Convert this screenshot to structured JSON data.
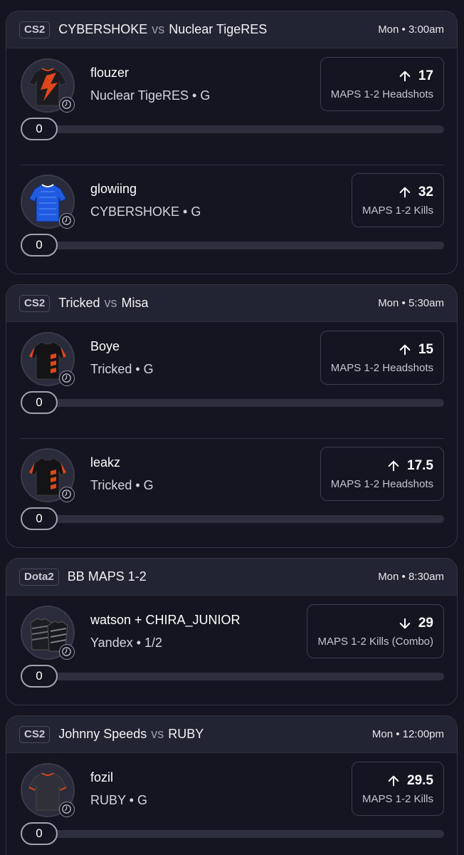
{
  "colors": {
    "background": "#141521",
    "card_header": "#232433",
    "border": "#333547",
    "text_primary": "#ffffff",
    "text_secondary": "#c3c4cd"
  },
  "matches": [
    {
      "game": "CS2",
      "team1": "CYBERSHOKE",
      "vs": "vs",
      "team2": "Nuclear TigeRES",
      "time": "Mon • 3:00am",
      "picks": [
        {
          "player": "flouzer",
          "meta": "Nuclear TigeRES • G",
          "direction": "up",
          "direction_icon": "arrow-up-icon",
          "line": "17",
          "market": "MAPS 1-2 Headshots",
          "slider_value": "0",
          "jersey": "orange-black"
        },
        {
          "player": "glowiing",
          "meta": "CYBERSHOKE • G",
          "direction": "up",
          "direction_icon": "arrow-up-icon",
          "line": "32",
          "market": "MAPS 1-2 Kills",
          "slider_value": "0",
          "jersey": "blue"
        }
      ]
    },
    {
      "game": "CS2",
      "team1": "Tricked",
      "vs": "vs",
      "team2": "Misa",
      "time": "Mon • 5:30am",
      "picks": [
        {
          "player": "Boye",
          "meta": "Tricked • G",
          "direction": "up",
          "direction_icon": "arrow-up-icon",
          "line": "15",
          "market": "MAPS 1-2 Headshots",
          "slider_value": "0",
          "jersey": "black-red"
        },
        {
          "player": "leakz",
          "meta": "Tricked • G",
          "direction": "up",
          "direction_icon": "arrow-up-icon",
          "line": "17.5",
          "market": "MAPS 1-2 Headshots",
          "slider_value": "0",
          "jersey": "black-red"
        }
      ]
    },
    {
      "game": "Dota2",
      "team1": "BB MAPS 1-2",
      "vs": "",
      "team2": "",
      "time": "Mon • 8:30am",
      "picks": [
        {
          "player": "watson + CHIRA_JUNIOR",
          "meta": "Yandex • 1/2",
          "direction": "down",
          "direction_icon": "arrow-down-icon",
          "line": "29",
          "market": "MAPS 1-2 Kills (Combo)",
          "slider_value": "0",
          "jersey": "combo"
        }
      ]
    },
    {
      "game": "CS2",
      "team1": "Johnny Speeds",
      "vs": "vs",
      "team2": "RUBY",
      "time": "Mon • 12:00pm",
      "picks": [
        {
          "player": "fozil",
          "meta": "RUBY • G",
          "direction": "up",
          "direction_icon": "arrow-up-icon",
          "line": "29.5",
          "market": "MAPS 1-2 Kills",
          "slider_value": "0",
          "jersey": "grey-red"
        }
      ]
    }
  ]
}
